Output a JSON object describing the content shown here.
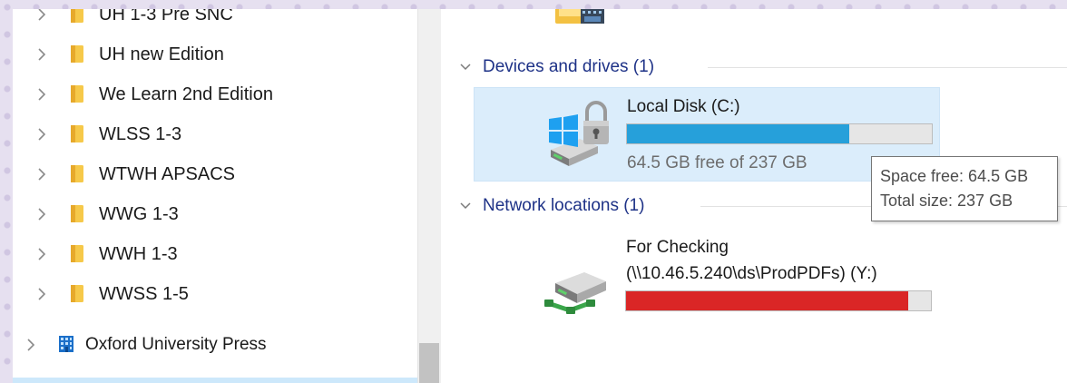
{
  "navigation": {
    "items": [
      {
        "label": "UH 1-3 Pre SNC"
      },
      {
        "label": "UH new Edition"
      },
      {
        "label": "We Learn 2nd Edition"
      },
      {
        "label": "WLSS 1-3"
      },
      {
        "label": "WTWH APSACS"
      },
      {
        "label": "WWG 1-3"
      },
      {
        "label": "WWH 1-3"
      },
      {
        "label": "WWSS 1-5"
      }
    ],
    "root": {
      "label": "Oxford University Press"
    }
  },
  "content": {
    "devices_group": {
      "title": "Devices and drives (1)"
    },
    "local_disk": {
      "name": "Local Disk (C:)",
      "space_text": "64.5 GB free of 237 GB",
      "used_fraction": 0.728
    },
    "network_group": {
      "title": "Network locations (1)"
    },
    "network_drive": {
      "name": "For Checking",
      "path": "(\\\\10.46.5.240\\ds\\ProdPDFs) (Y:)",
      "used_fraction": 0.925
    },
    "tooltip": {
      "line1": "Space free: 64.5 GB",
      "line2": "Total size: 237 GB"
    }
  },
  "colors": {
    "folder_yellow": "#f6c94a",
    "group_title_blue": "#1e3287",
    "disk_bar_blue": "#26a0da",
    "disk_bar_red": "#da2626",
    "selection_blue": "#dbedfb"
  },
  "icons": {
    "tree_expand": "chevron-right-icon",
    "folder": "folder-icon",
    "root": "building-icon",
    "group_collapse": "chevron-down-icon",
    "local_disk": "windows-drive-lock-icon",
    "network_drive": "network-drive-icon"
  }
}
